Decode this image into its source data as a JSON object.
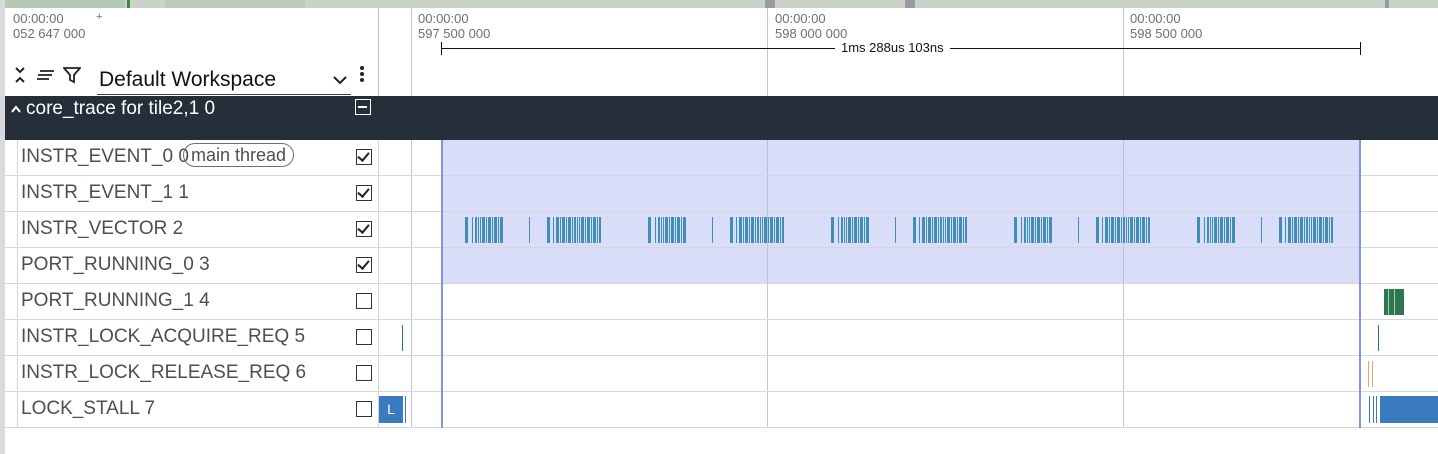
{
  "timeline": {
    "origin_time": {
      "line1": "00:00:00",
      "line2": "052 647 000",
      "plus": "+"
    },
    "ticks": [
      {
        "line1": "00:00:00",
        "line2": "597 500 000"
      },
      {
        "line1": "00:00:00",
        "line2": "598 000 000"
      },
      {
        "line1": "00:00:00",
        "line2": "598 500 000"
      }
    ],
    "span_label": "1ms 288us 103ns"
  },
  "header": {
    "workspace": "Default Workspace",
    "icons": [
      "collapse-all-icon",
      "sort-icon",
      "filter-icon",
      "chevron-down-icon",
      "more-vert-icon"
    ]
  },
  "group": {
    "title": "core_trace for tile2,1 0",
    "caret": "^",
    "collapsed": false
  },
  "tracks": [
    {
      "name": "INSTR_EVENT_0 0",
      "chip": "main thread",
      "checked": true
    },
    {
      "name": "INSTR_EVENT_1 1",
      "checked": true
    },
    {
      "name": "INSTR_VECTOR 2",
      "checked": true
    },
    {
      "name": "PORT_RUNNING_0 3",
      "checked": true
    },
    {
      "name": "PORT_RUNNING_1 4",
      "checked": false
    },
    {
      "name": "INSTR_LOCK_ACQUIRE_REQ 5",
      "checked": false
    },
    {
      "name": "INSTR_LOCK_RELEASE_REQ 6",
      "checked": false
    },
    {
      "name": "LOCK_STALL 7",
      "checked": false
    }
  ],
  "slice_labels": {
    "lock_stall_left": "L"
  },
  "colors": {
    "group_bar": "#262e3a",
    "selection": "#aab4f0",
    "vector_slices": "#3f8fb4",
    "port_running": "#2e7552",
    "lock_stall": "#3a7bbf",
    "lock_release": "#f0a080"
  }
}
